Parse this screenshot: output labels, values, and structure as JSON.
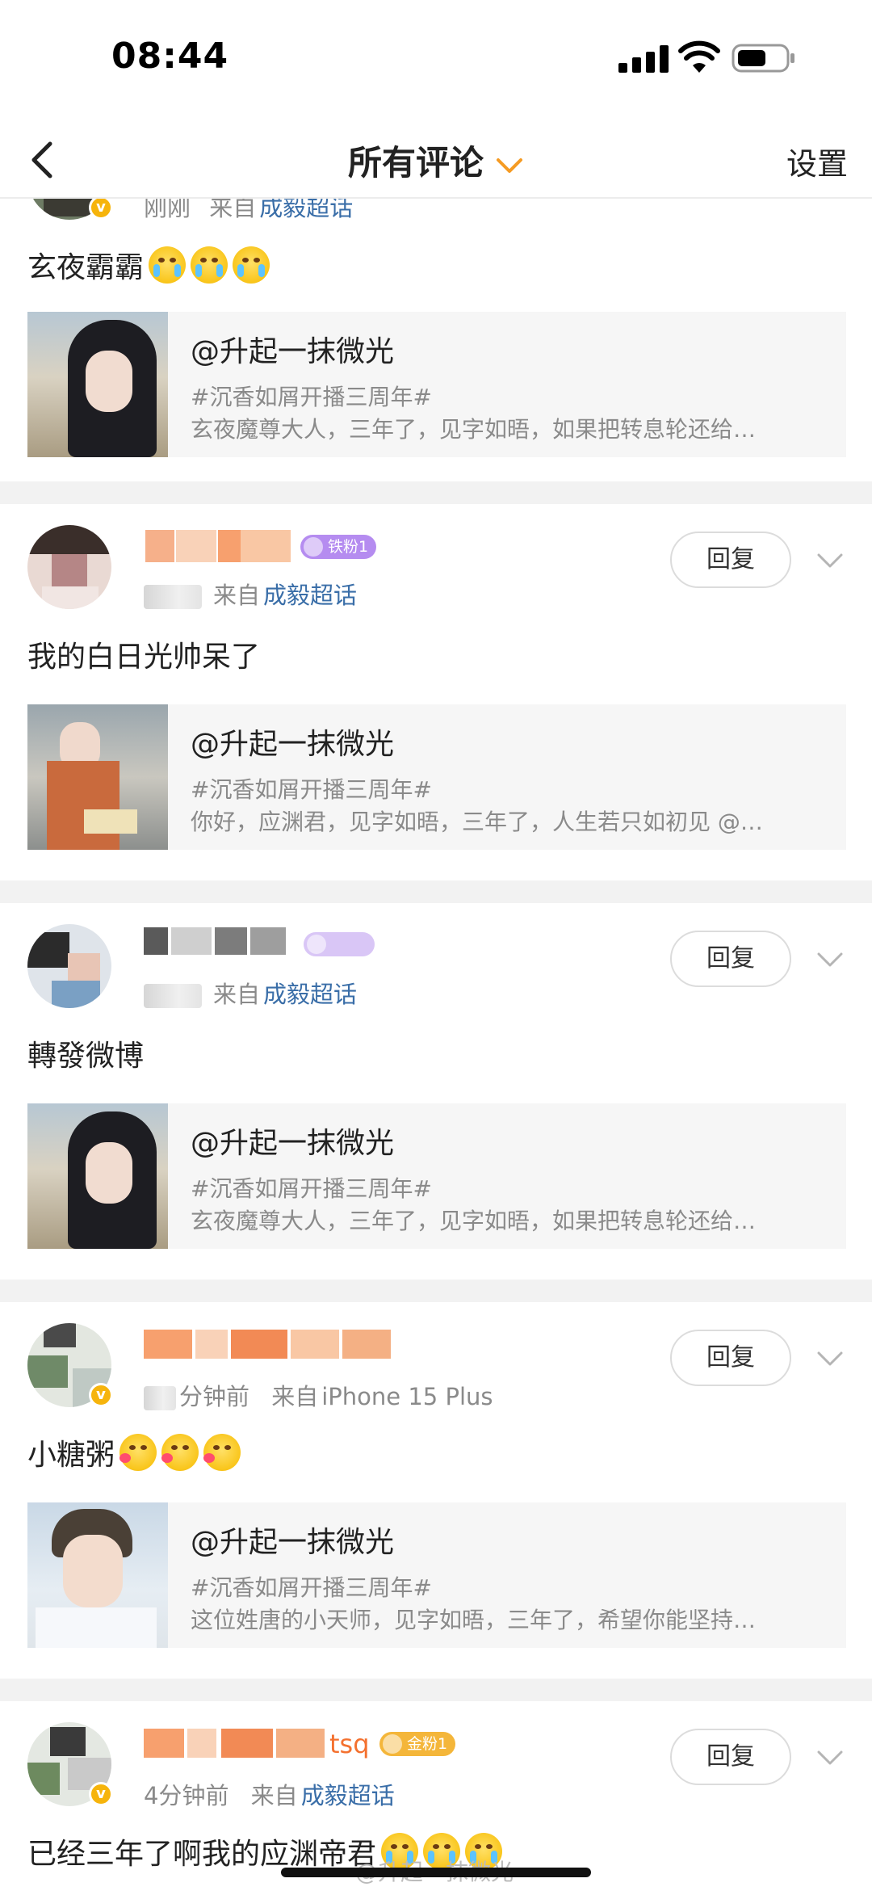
{
  "status": {
    "time": "08:44"
  },
  "nav": {
    "title": "所有评论",
    "settings": "设置"
  },
  "first": {
    "meta_time": "刚刚",
    "meta_from": "来自",
    "meta_link": "成毅超话",
    "text": "玄夜霸霸",
    "card": {
      "title": "@升起一抹微光",
      "tag": "#沉香如屑开播三周年#",
      "desc": "玄夜魔尊大人，三年了，见字如晤，如果把转息轮还给…"
    }
  },
  "comments": [
    {
      "fan_badge": "铁粉1",
      "meta_from": "来自",
      "meta_link": "成毅超话",
      "reply": "回复",
      "text": "我的白日光帅呆了",
      "card": {
        "title": "@升起一抹微光",
        "tag": "#沉香如屑开播三周年#",
        "desc": "你好，应渊君，见字如晤，三年了，人生若只如初见 @…"
      }
    },
    {
      "fan_badge": "",
      "meta_from": "来自",
      "meta_link": "成毅超话",
      "reply": "回复",
      "text": "轉發微博",
      "card": {
        "title": "@升起一抹微光",
        "tag": "#沉香如屑开播三周年#",
        "desc": "玄夜魔尊大人，三年了，见字如晤，如果把转息轮还给…"
      }
    },
    {
      "fan_badge": "",
      "meta_time_tail": "分钟前",
      "meta_from": "来自",
      "meta_link": "iPhone 15 Plus",
      "reply": "回复",
      "text": "小糖粥",
      "card": {
        "title": "@升起一抹微光",
        "tag": "#沉香如屑开播三周年#",
        "desc": "这位姓唐的小天师，见字如晤，三年了，希望你能坚持…"
      }
    },
    {
      "name_tail": "tsq",
      "fan_badge": "金粉1",
      "meta_time": "4分钟前",
      "meta_from": "来自",
      "meta_link": "成毅超话",
      "reply": "回复",
      "text": "已经三年了啊我的应渊帝君"
    }
  ],
  "watermark": "@升起一抹微光",
  "colors": {
    "link": "#3a6ea8",
    "accent": "#f59b23",
    "fan_purple": "#b58cf0",
    "fan_gold": "#f4b63a",
    "separator": "#f2f2f2"
  }
}
